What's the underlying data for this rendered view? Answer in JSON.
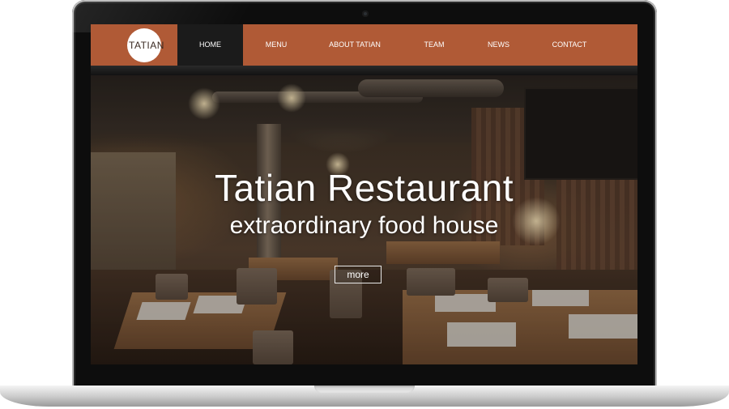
{
  "brand": {
    "logo_text": "TATIAN"
  },
  "nav": {
    "items": [
      {
        "label": "HOME",
        "active": true
      },
      {
        "label": "MENU",
        "active": false
      },
      {
        "label": "ABOUT TATIAN",
        "active": false
      },
      {
        "label": "TEAM",
        "active": false
      },
      {
        "label": "NEWS",
        "active": false
      },
      {
        "label": "CONTACT",
        "active": false
      }
    ]
  },
  "hero": {
    "title": "Tatian Restaurant",
    "subtitle": "extraordinary food house",
    "button_label": "more"
  },
  "colors": {
    "nav_background": "#b05a36",
    "nav_active_background": "#1b1b1b",
    "text_on_hero": "#ffffff"
  }
}
